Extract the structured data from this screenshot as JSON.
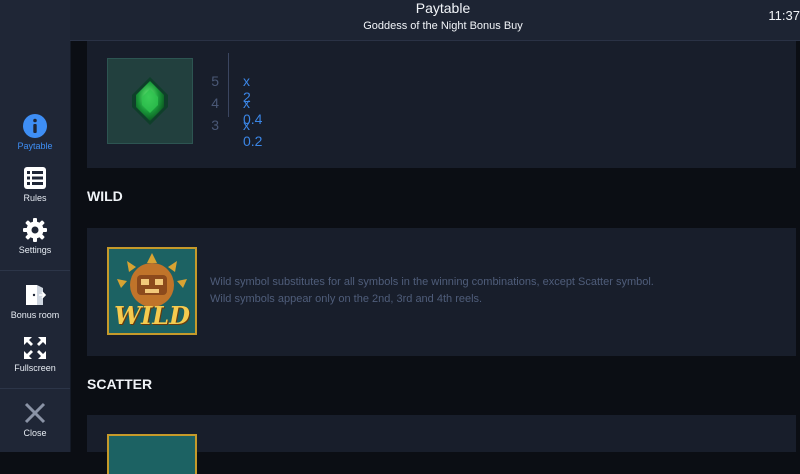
{
  "sidebar": {
    "items": [
      {
        "id": "paytable",
        "label": "Paytable",
        "icon": "info-icon",
        "active": true
      },
      {
        "id": "rules",
        "label": "Rules",
        "icon": "list-icon",
        "active": false
      },
      {
        "id": "settings",
        "label": "Settings",
        "icon": "gear-icon",
        "active": false
      },
      {
        "id": "bonus_room",
        "label": "Bonus room",
        "icon": "door-icon",
        "active": false
      },
      {
        "id": "fullscreen",
        "label": "Fullscreen",
        "icon": "fullscreen-icon",
        "active": false
      },
      {
        "id": "close",
        "label": "Close",
        "icon": "close-icon",
        "active": false
      }
    ],
    "accent_color": "#3e8ef5"
  },
  "header": {
    "title": "Paytable",
    "subtitle": "Goddess of the Night Bonus Buy",
    "time": "11:37"
  },
  "gem_symbol": {
    "icon": "green-gem-icon",
    "payouts": [
      {
        "count": "5",
        "multiplier": "x 2"
      },
      {
        "count": "4",
        "multiplier": "x 0.4"
      },
      {
        "count": "3",
        "multiplier": "x 0.2"
      }
    ]
  },
  "wild": {
    "heading": "WILD",
    "symbol_text": "WILD",
    "description_line1": "Wild symbol substitutes for all symbols in the winning combinations, except Scatter symbol.",
    "description_line2": "Wild symbols appear only on the 2nd, 3rd and 4th reels."
  },
  "scatter": {
    "heading": "SCATTER",
    "icon": "scatter-symbol-icon"
  }
}
